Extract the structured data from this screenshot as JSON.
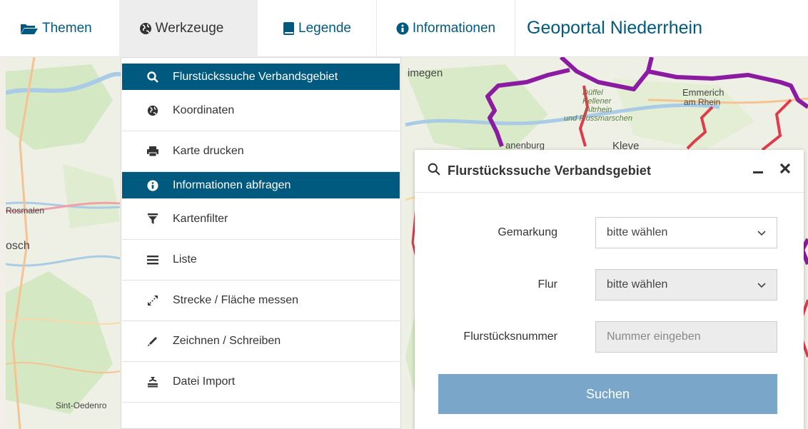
{
  "nav": {
    "themen": "Themen",
    "werkzeuge": "Werkzeuge",
    "legende": "Legende",
    "informationen": "Informationen",
    "brand": "Geoportal Niederrhein"
  },
  "tools": [
    {
      "label": "Flurstückssuche Verbandsgebiet",
      "icon": "search-icon",
      "active": true
    },
    {
      "label": "Koordinaten",
      "icon": "globe-icon",
      "active": false
    },
    {
      "label": "Karte drucken",
      "icon": "printer-icon",
      "active": false
    },
    {
      "label": "Informationen abfragen",
      "icon": "info-icon",
      "active": true
    },
    {
      "label": "Kartenfilter",
      "icon": "filter-icon",
      "active": false
    },
    {
      "label": "Liste",
      "icon": "list-icon",
      "active": false
    },
    {
      "label": "Strecke / Fläche messen",
      "icon": "measure-icon",
      "active": false
    },
    {
      "label": "Zeichnen / Schreiben",
      "icon": "pencil-icon",
      "active": false
    },
    {
      "label": "Datei Import",
      "icon": "import-icon",
      "active": false
    }
  ],
  "map_labels": {
    "nijmegen": "imegen",
    "duffel": "Düffel",
    "kellener": "Kellener",
    "altrhein": "Altrhein",
    "flussmarschen": "und Flussmarschen",
    "emmerich": "Emmerich",
    "amrhein": "am Rhein",
    "kranenburg": "anenburg",
    "kleve": "Kleve",
    "gosmalen": "Rosmalen",
    "osch": "osch",
    "oedenrode": "Sint-Oedenro"
  },
  "panel": {
    "title": "Flurstückssuche Verbandsgebiet",
    "gemarkung_label": "Gemarkung",
    "gemarkung_value": "bitte wählen",
    "flur_label": "Flur",
    "flur_value": "bitte wählen",
    "nummer_label": "Flurstücksnummer",
    "nummer_placeholder": "Nummer eingeben",
    "search_button": "Suchen"
  },
  "colors": {
    "primary": "#005a80",
    "active_bg": "#005a80",
    "search_button": "#7aa7c9",
    "boundary_purple": "#8b1ba0",
    "boundary_red": "#e03b4a"
  }
}
